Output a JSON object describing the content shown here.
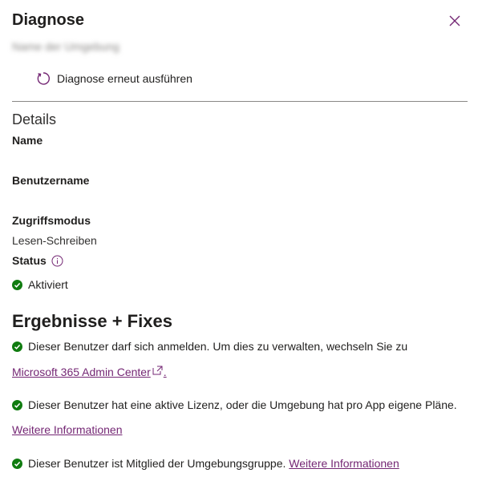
{
  "panel": {
    "title": "Diagnose",
    "subtitle": "Name der Umgebung"
  },
  "toolbar": {
    "rerun_label": "Diagnose erneut ausführen"
  },
  "details": {
    "heading": "Details",
    "name_label": "Name",
    "name_value": "",
    "username_label": "Benutzername",
    "username_value": "",
    "access_label": "Zugriffsmodus",
    "access_value": "Lesen-Schreiben",
    "status_label": "Status",
    "status_value": "Aktiviert"
  },
  "results": {
    "heading": "Ergebnisse + Fixes",
    "items": [
      {
        "text": "Dieser Benutzer darf sich anmelden. Um dies zu verwalten, wechseln Sie zu",
        "link": "Microsoft 365 Admin Center",
        "suffix": "."
      },
      {
        "text": "Dieser Benutzer hat eine aktive Lizenz, oder die Umgebung hat pro App eigene Pläne.",
        "link": "Weitere Informationen"
      },
      {
        "text": "Dieser Benutzer ist Mitglied der Umgebungsgruppe.",
        "link": "Weitere Informationen"
      }
    ]
  },
  "colors": {
    "accent_link": "#742774",
    "success": "#107c10",
    "text": "#201f1e"
  },
  "icons": {
    "close": "close-icon",
    "rerun": "refresh-icon",
    "info": "info-icon",
    "check": "checkmark-circle-icon",
    "external": "external-link-icon"
  }
}
